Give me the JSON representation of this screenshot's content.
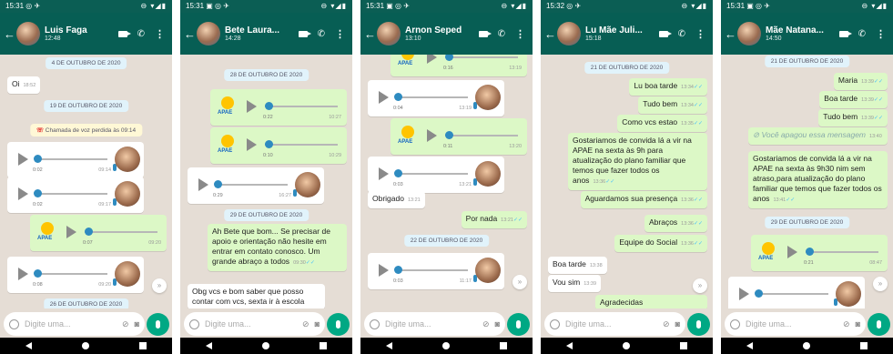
{
  "screens": [
    {
      "status_time": "15:31",
      "status_icons": "◎ ✈",
      "status_right": "⊖ ▾◢▮",
      "name": "Luis Faga",
      "sub": "12:48",
      "pills": [
        "4 DE OUTUBRO DE 2020",
        "19 DE OUTUBRO DE 2020",
        "26 DE OUTUBRO DE 2020"
      ],
      "call": "Chamada de voz perdida às 09:14",
      "msgs": [
        {
          "text": "Oi",
          "time": "18:52"
        }
      ],
      "audios": [
        {
          "dur": "0:02",
          "time": "09:14"
        },
        {
          "dur": "0:02",
          "time": "09:17"
        },
        {
          "dur": "0:07",
          "time": "09:20"
        },
        {
          "dur": "0:08",
          "time": "09:20"
        }
      ]
    },
    {
      "status_time": "15:31",
      "status_icons": "▣ ◎ ✈",
      "status_right": "⊖ ▾◢▮",
      "name": "Bete Laura...",
      "sub": "14:28",
      "pills": [
        "28 DE OUTUBRO DE 2020",
        "29 DE OUTUBRO DE 2020"
      ],
      "msgs": [
        {
          "text": "Ah Bete que bom... Se precisar de apoio e orientação não hesite em entrar em contato conosco. Um grande abraço a todos",
          "time": "09:30"
        },
        {
          "text": "Obg vcs  e bom saber que posso contar com vcs, sexta ir à escola",
          "time": ""
        }
      ],
      "audios": [
        {
          "dur": "0:22",
          "time": "10:27"
        },
        {
          "dur": "0:10",
          "time": "10:29"
        },
        {
          "dur": "0:29",
          "time": "16:27"
        }
      ]
    },
    {
      "status_time": "15:31",
      "status_icons": "▣ ◎ ✈",
      "status_right": "⊖ ▾◢▮",
      "name": "Arnon Seped",
      "sub": "13:10",
      "pills": [
        "22 DE OUTUBRO DE 2020"
      ],
      "msgs": [
        {
          "text": "Obrigado",
          "time": "13:21"
        },
        {
          "text": "Por nada",
          "time": "13:21"
        }
      ],
      "audios": [
        {
          "dur": "0:16",
          "time": "13:19"
        },
        {
          "dur": "0:04",
          "time": "13:19"
        },
        {
          "dur": "0:11",
          "time": "13:20"
        },
        {
          "dur": "0:03",
          "time": "13:21"
        },
        {
          "dur": "0:03",
          "time": "11:17"
        }
      ]
    },
    {
      "status_time": "15:32",
      "status_icons": "◎ ✈",
      "status_right": "⊖ ▾◢▮",
      "name": "Lu Mãe Juli...",
      "sub": "15:18",
      "pills": [
        "21 DE OUTUBRO DE 2020"
      ],
      "msgs": [
        {
          "text": "Lu boa tarde",
          "time": "13:34"
        },
        {
          "text": "Tudo bem",
          "time": "13:34"
        },
        {
          "text": "Como vcs estao",
          "time": "13:35"
        },
        {
          "text": "Gostariamos de convida lá a vir na APAE na sexta às 9h para atualização do plano familiar que temos que fazer todos os anos",
          "time": "13:36"
        },
        {
          "text": "Aguardamos sua presença",
          "time": "13:36"
        },
        {
          "text": "Abraços",
          "time": "13:36"
        },
        {
          "text": "Equipe do Social",
          "time": "13:36"
        },
        {
          "text": "Boa tarde",
          "time": "13:38"
        },
        {
          "text": "Vou sim",
          "time": "13:39"
        },
        {
          "text": "Agradecidas",
          "time": ""
        }
      ],
      "audios": []
    },
    {
      "status_time": "15:31",
      "status_icons": "▣ ◎ ✈",
      "status_right": "⊖ ▾◢▮",
      "name": "Mãe Natana...",
      "sub": "14:50",
      "pills": [
        "21 DE OUTUBRO DE 2020",
        "29 DE OUTUBRO DE 2020"
      ],
      "msgs": [
        {
          "text": "Maria",
          "time": "13:39"
        },
        {
          "text": "Boa tarde",
          "time": "13:39"
        },
        {
          "text": "Tudo bem",
          "time": "13:39"
        },
        {
          "text": "Você apagou essa mensagem",
          "time": "13:40"
        },
        {
          "text": "Gostariamos de convida lá a vir na APAE na sexta às 9h30 nim sem atraso,para atualização do plano familiar que temos que fazer todos os anos",
          "time": "13:41"
        }
      ],
      "audios": [
        {
          "dur": "0:21",
          "time": "08:47"
        },
        {
          "dur": "",
          "time": ""
        }
      ]
    }
  ],
  "input_placeholder": "Digite uma...",
  "logo_text": "APAE",
  "colors": {
    "header": "#075e54",
    "out_bubble": "#dcf8c6",
    "accent": "#00a884"
  }
}
